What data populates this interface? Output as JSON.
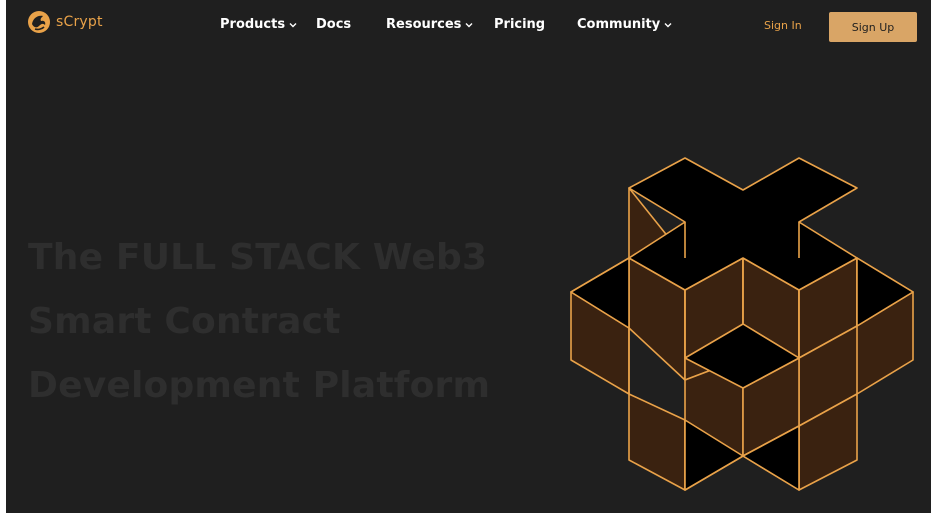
{
  "brand": {
    "name": "sCrypt"
  },
  "nav": {
    "items": [
      {
        "label": "Products",
        "has_dropdown": true
      },
      {
        "label": "Docs",
        "has_dropdown": false
      },
      {
        "label": "Resources",
        "has_dropdown": true
      },
      {
        "label": "Pricing",
        "has_dropdown": false
      },
      {
        "label": "Community",
        "has_dropdown": true
      }
    ],
    "chevron_icon": "chevron-down-icon"
  },
  "auth": {
    "sign_in": "Sign In",
    "sign_up": "Sign Up"
  },
  "hero": {
    "title_lines": [
      "The FULL STACK Web3",
      "Smart Contract",
      "Development Platform"
    ]
  },
  "colors": {
    "background": "#1f1f1f",
    "accent": "#e9a249",
    "button": "#d9a566",
    "hero_text": "#2e2e2e",
    "cube_fill": "#3a2210",
    "cube_dark": "#000000",
    "cube_stroke": "#e9a249"
  }
}
